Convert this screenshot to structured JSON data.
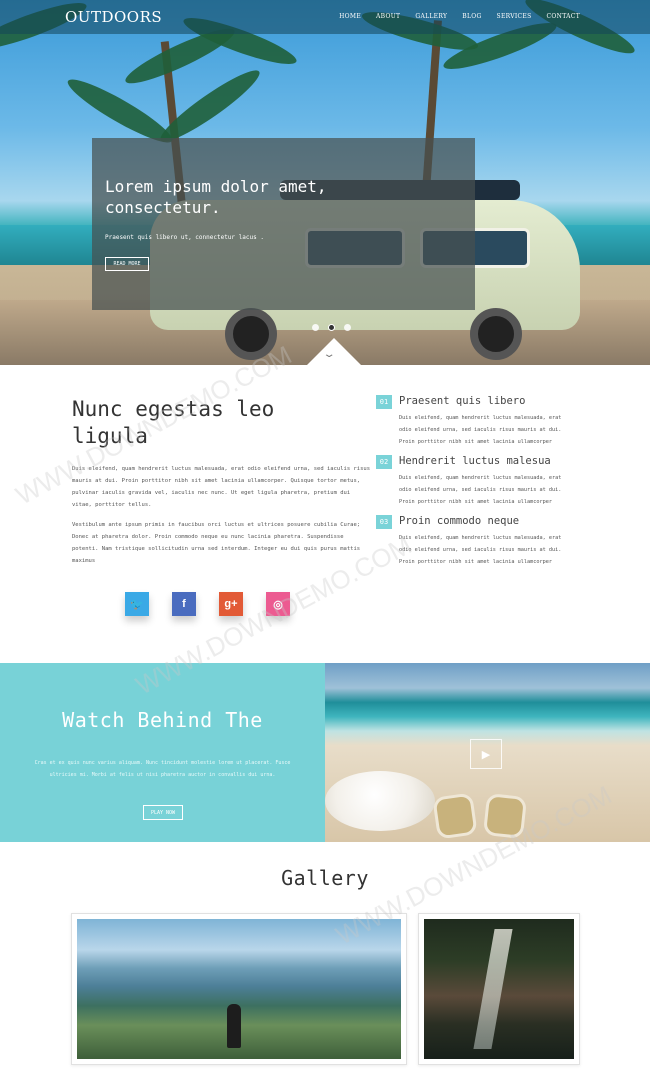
{
  "brand": {
    "logo": "OUTDOORS"
  },
  "nav": {
    "items": [
      "HOME",
      "ABOUT",
      "GALLERY",
      "BLOG",
      "SERVICES",
      "CONTACT"
    ]
  },
  "hero": {
    "title": "Lorem ipsum dolor amet, consectetur.",
    "subtitle": "Praesent quis libero ut, connectetur lacus .",
    "button": "READ MORE",
    "slides": 3,
    "active_slide": 2
  },
  "about": {
    "title": "Nunc egestas leo ligula",
    "paragraph1": "Duis eleifend, quam hendrerit luctus malesuada, erat odio eleifend urna, sed iaculis risus mauris at dui. Proin porttitor nibh sit amet lacinia ullamcorper. Quisque tortor metus, pulvinar iaculis gravida vel, iaculis nec nunc. Ut eget ligula pharetra, pretium dui vitae, porttitor tellus.",
    "paragraph2": "Vestibulum ante ipsum primis in faucibus orci luctus et ultrices posuere cubilia Curae; Donec at pharetra dolor. Proin commodo neque eu nunc lacinia pharetra. Suspendisse potenti. Nam tristique sollicitudin urna sed interdum. Integer eu dui quis purus mattis maximus",
    "social": [
      {
        "name": "twitter",
        "glyph": "🐦",
        "color": "#3aa9e6"
      },
      {
        "name": "facebook",
        "glyph": "f",
        "color": "#4a6cbf"
      },
      {
        "name": "google-plus",
        "glyph": "g+",
        "color": "#e25a36"
      },
      {
        "name": "dribbble",
        "glyph": "◎",
        "color": "#ec5b91"
      }
    ]
  },
  "features": [
    {
      "num": "01",
      "title": "Praesent quis libero",
      "text": "Duis eleifend, quam hendrerit luctus malesuada, erat odio eleifend urna, sed iaculis risus mauris at dui. Proin porttitor nibh sit amet lacinia ullamcorper"
    },
    {
      "num": "02",
      "title": "Hendrerit luctus malesua",
      "text": "Duis eleifend, quam hendrerit luctus malesuada, erat odio eleifend urna, sed iaculis risus mauris at dui. Proin porttitor nibh sit amet lacinia ullamcorper"
    },
    {
      "num": "03",
      "title": "Proin commodo neque",
      "text": "Duis eleifend, quam hendrerit luctus malesuada, erat odio eleifend urna, sed iaculis risus mauris at dui. Proin porttitor nibh sit amet lacinia ullamcorper"
    }
  ],
  "watch": {
    "title": "Watch Behind The",
    "text": "Cras et ex quis nunc varius aliquam. Nunc tincidunt molestie lorem ut placerat. Fusce ultricies mi. Morbi at felis ut nisi pharetra auctor in convallis dui urna.",
    "button": "PLAY NOW",
    "accent": "#78d2d7"
  },
  "gallery": {
    "title": "Gallery"
  },
  "watermark": {
    "text": "WWW.DOWNDEMO.COM"
  }
}
